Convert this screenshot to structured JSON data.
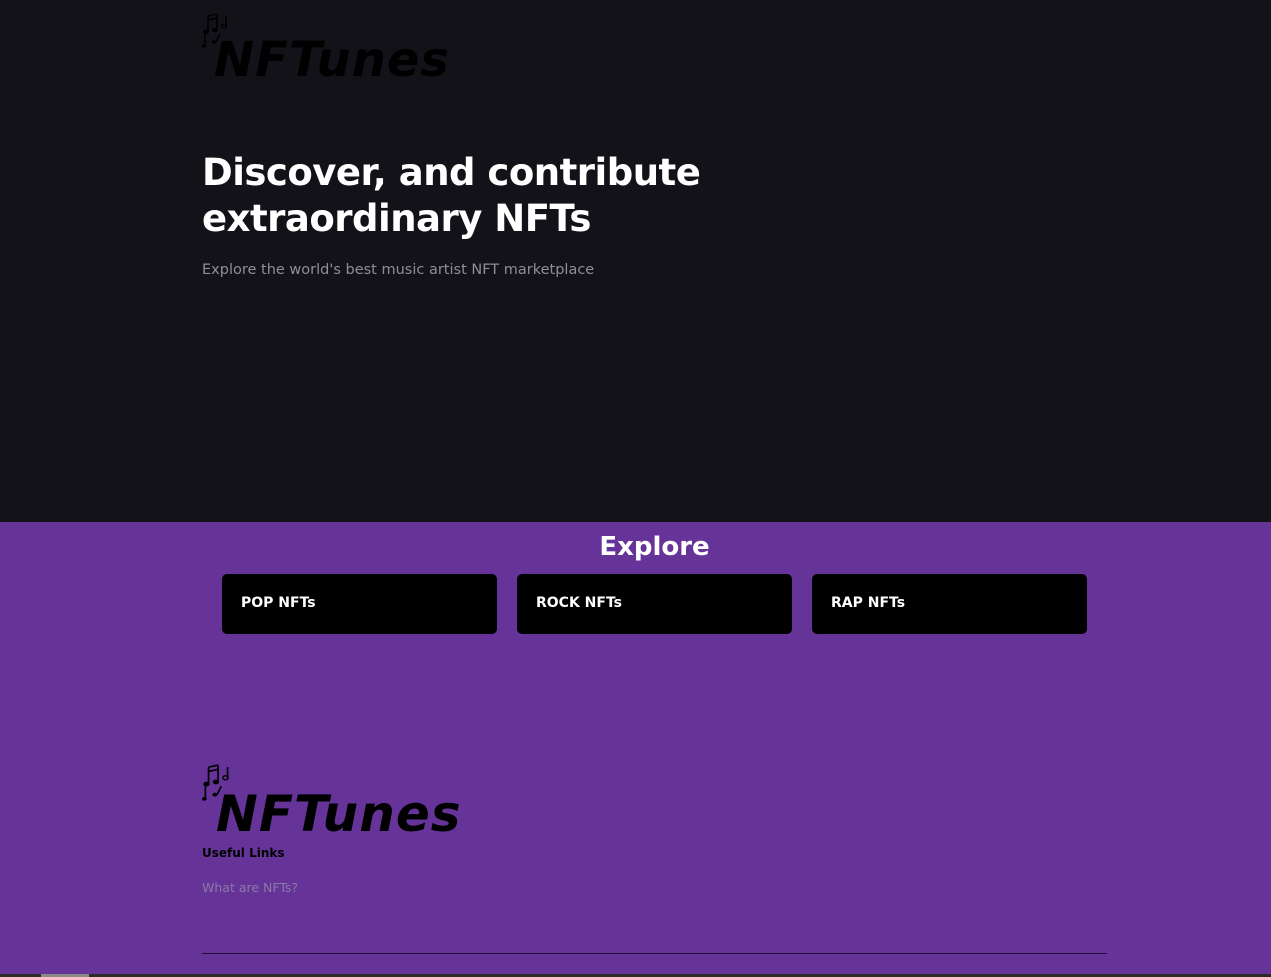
{
  "brand": {
    "name": "NFTunes",
    "icon": "music-notes-icon"
  },
  "hero": {
    "title_line1": "Discover, and contribute",
    "title_line2": "extraordinary NFTs",
    "subtitle": "Explore the world's best music artist NFT marketplace"
  },
  "explore": {
    "title": "Explore",
    "categories": [
      {
        "label": "POP NFTs"
      },
      {
        "label": "ROCK NFTs"
      },
      {
        "label": "RAP NFTs"
      }
    ]
  },
  "footer": {
    "useful_links_heading": "Useful Links",
    "links": [
      {
        "label": "What are NFTs?"
      }
    ]
  },
  "colors": {
    "hero_background": "#131218",
    "accent_purple": "#663399",
    "card_background": "#000000",
    "text_white": "#ffffff",
    "text_muted": "#8f8e96"
  }
}
